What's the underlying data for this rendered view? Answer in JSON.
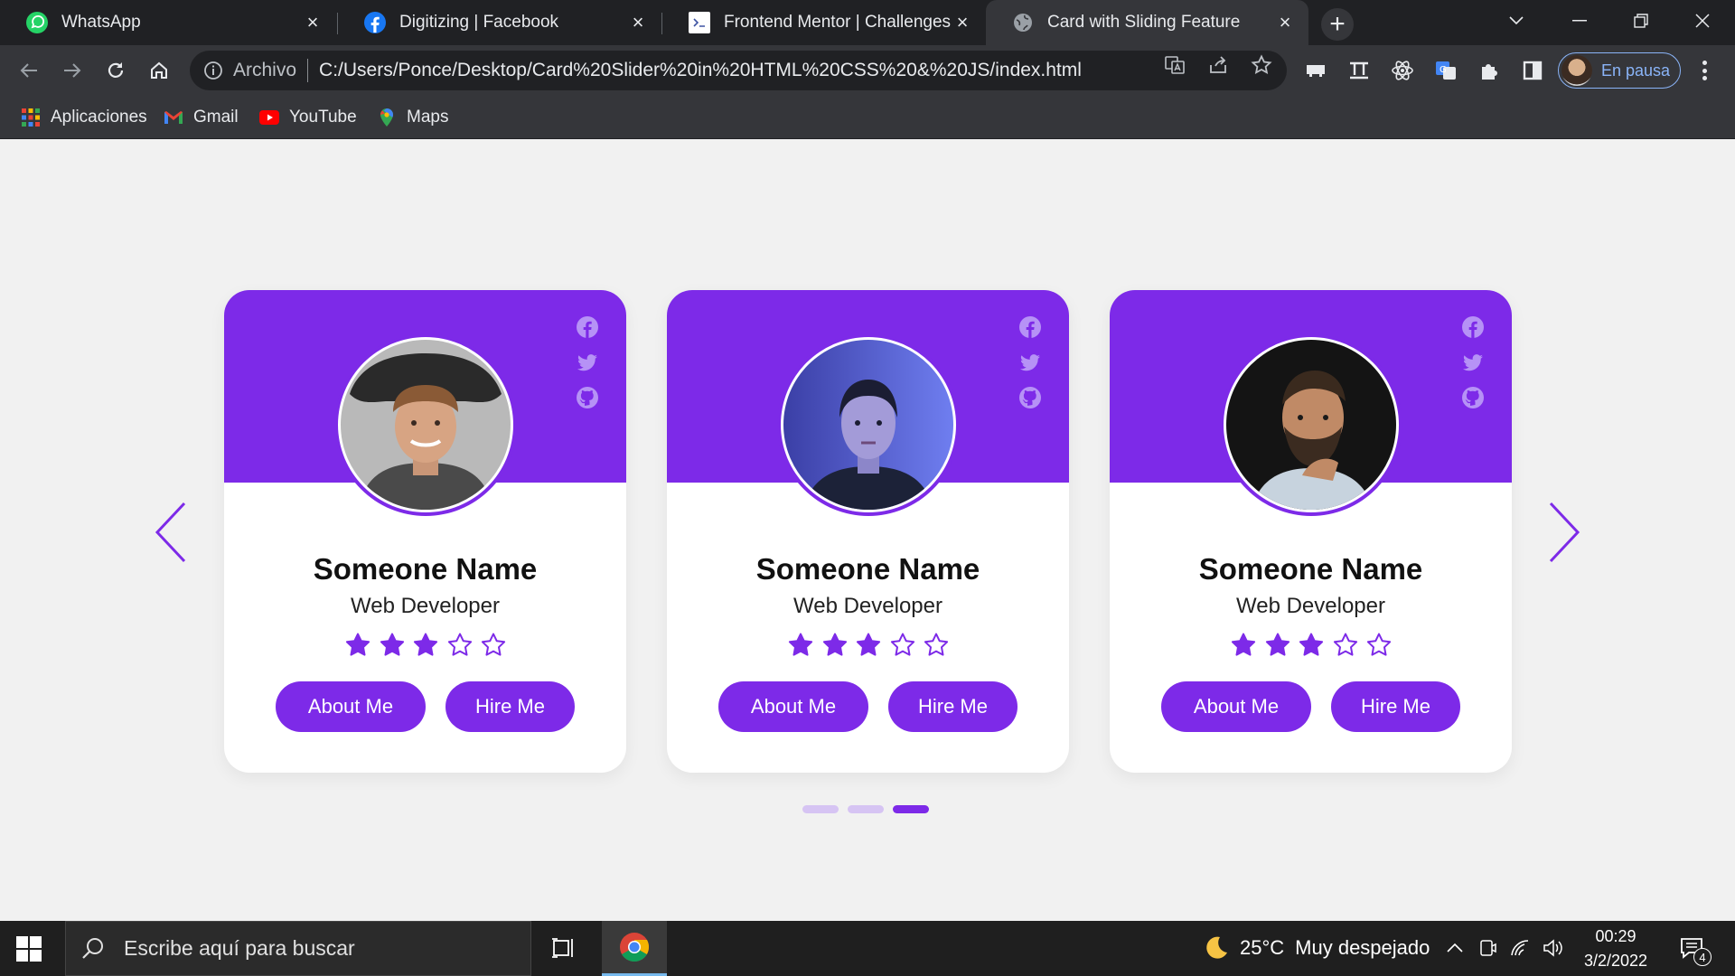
{
  "browser": {
    "tabs": [
      {
        "title": "WhatsApp",
        "icon": "whatsapp-icon",
        "active": false
      },
      {
        "title": "Digitizing | Facebook",
        "icon": "facebook-icon",
        "active": false
      },
      {
        "title": "Frontend Mentor | Challenges",
        "icon": "frontend-mentor-icon",
        "active": false
      },
      {
        "title": "Card with Sliding Feature",
        "icon": "globe-icon",
        "active": true
      }
    ],
    "address": {
      "scheme_label": "Archivo",
      "url": "C:/Users/Ponce/Desktop/Card%20Slider%20in%20HTML%20CSS%20&%20JS/index.html"
    },
    "profile_label": "En pausa",
    "bookmarks": [
      {
        "label": "Aplicaciones",
        "icon": "apps-grid-icon"
      },
      {
        "label": "Gmail",
        "icon": "gmail-icon"
      },
      {
        "label": "YouTube",
        "icon": "youtube-icon"
      },
      {
        "label": "Maps",
        "icon": "maps-icon"
      }
    ]
  },
  "colors": {
    "accent": "#7d2ae8",
    "accent_light": "#d6c4f3",
    "page_bg": "#f1f1f1",
    "chrome_dark": "#202124",
    "chrome_mid": "#35363a"
  },
  "cards": [
    {
      "name": "Someone Name",
      "role": "Web Developer",
      "rating": 3,
      "max_rating": 5,
      "about_label": "About Me",
      "hire_label": "Hire Me",
      "photo": "man-curly-hair-hat"
    },
    {
      "name": "Someone Name",
      "role": "Web Developer",
      "rating": 3,
      "max_rating": 5,
      "about_label": "About Me",
      "hire_label": "Hire Me",
      "photo": "woman-blue-light"
    },
    {
      "name": "Someone Name",
      "role": "Web Developer",
      "rating": 3,
      "max_rating": 5,
      "about_label": "About Me",
      "hire_label": "Hire Me",
      "photo": "bearded-man-dark"
    }
  ],
  "slider": {
    "page_count": 3,
    "active_page": 3
  },
  "taskbar": {
    "search_placeholder": "Escribe aquí para buscar",
    "weather": {
      "temp": "25°C",
      "condition": "Muy despejado"
    },
    "time": "00:29",
    "date": "3/2/2022",
    "notification_count": "4"
  }
}
